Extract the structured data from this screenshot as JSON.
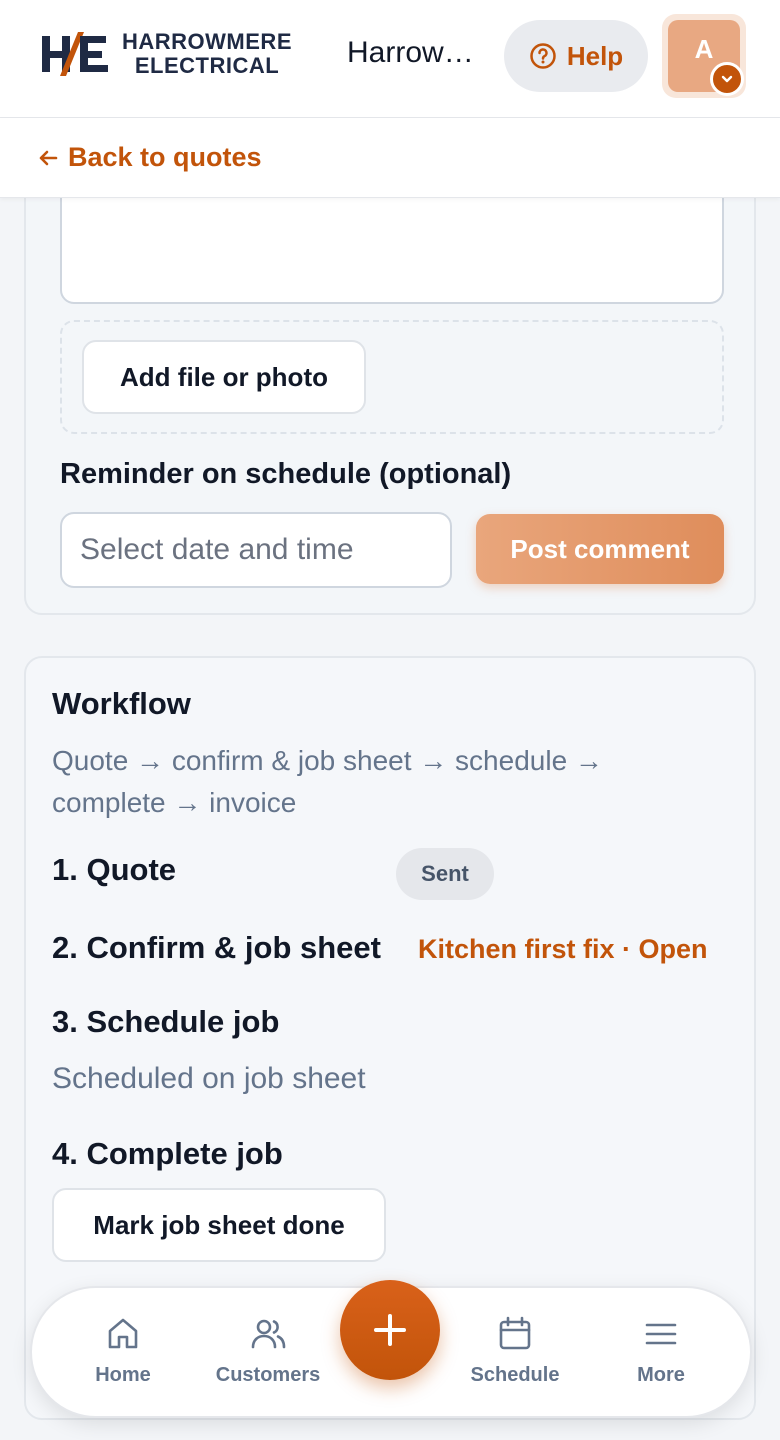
{
  "brand": {
    "line1": "HARROWMERE",
    "line2": "ELECTRICAL",
    "company_name": "Harrowmere Electrical",
    "accent_color": "#c2540a",
    "navy_color": "#1f2a44"
  },
  "header": {
    "help_label": "Help",
    "avatar_initial": "A"
  },
  "back": {
    "label": "Back to quotes"
  },
  "comment": {
    "textarea_value": "",
    "add_file_label": "Add file or photo",
    "reminder_label": "Reminder on schedule (optional)",
    "date_placeholder": "Select date and time",
    "post_label": "Post comment"
  },
  "workflow": {
    "title": "Workflow",
    "description": "Quote → confirm & job sheet → schedule → complete → invoice",
    "steps": [
      {
        "title": "1. Quote",
        "status": "Sent"
      },
      {
        "title": "2. Confirm & job sheet",
        "link": "Kitchen first fix · Open"
      },
      {
        "title": "3. Schedule job",
        "detail": "Scheduled on job sheet"
      },
      {
        "title": "4. Complete job",
        "action": "Mark job sheet done"
      }
    ]
  },
  "nav": {
    "items": [
      {
        "label": "Home",
        "icon": "home-icon"
      },
      {
        "label": "Customers",
        "icon": "users-icon"
      },
      {
        "label": "Schedule",
        "icon": "calendar-icon"
      },
      {
        "label": "More",
        "icon": "menu-icon"
      }
    ],
    "fab_icon": "plus-icon"
  }
}
